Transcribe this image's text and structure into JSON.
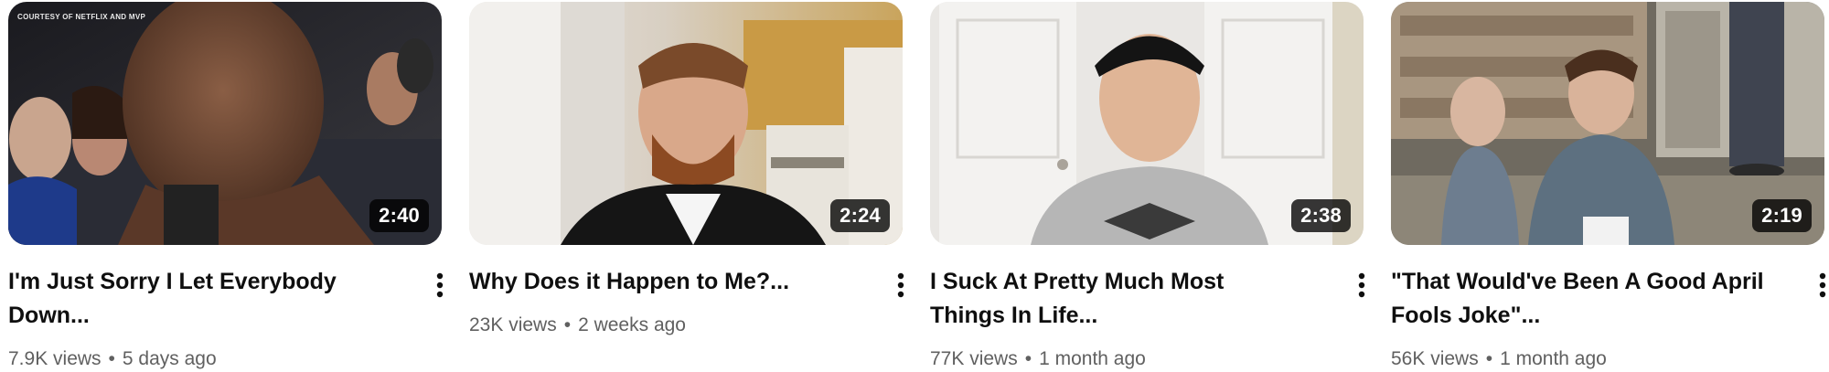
{
  "videos": [
    {
      "title": "I'm Just Sorry I Let Everybody Down...",
      "views": "7.9K views",
      "separator": "•",
      "age": "5 days ago",
      "duration": "2:40",
      "watermark": "COURTESY OF NETFLIX AND MVP"
    },
    {
      "title": "Why Does it Happen to Me?...",
      "views": "23K views",
      "separator": "•",
      "age": "2 weeks ago",
      "duration": "2:24"
    },
    {
      "title": "I Suck At Pretty Much Most Things In Life...",
      "views": "77K views",
      "separator": "•",
      "age": "1 month ago",
      "duration": "2:38"
    },
    {
      "title": "\"That Would've Been A Good April Fools Joke\"...",
      "views": "56K views",
      "separator": "•",
      "age": "1 month ago",
      "duration": "2:19"
    }
  ],
  "icons": {
    "more_actions": "more-vert-icon"
  },
  "colors": {
    "title": "#0f0f0f",
    "meta": "#606060",
    "duration_badge": "#000000"
  }
}
